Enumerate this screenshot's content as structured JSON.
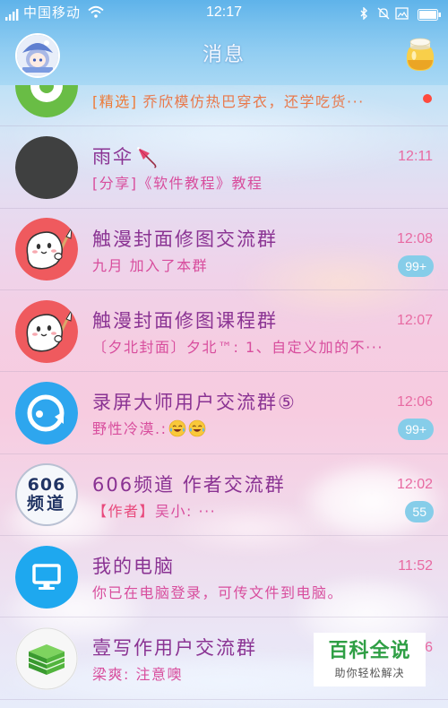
{
  "status_bar": {
    "carrier": "中国移动",
    "time": "12:17",
    "icons": [
      "signal-icon",
      "wifi-icon",
      "bluetooth-icon",
      "mute-bell-icon",
      "screenshot-icon",
      "battery-icon"
    ]
  },
  "header": {
    "title": "消息",
    "left_icon": "profile-avatar",
    "right_icon": "honey-jar-icon"
  },
  "conversations": [
    {
      "avatar": "green-ring-avatar",
      "preview_tag": "[精选]",
      "preview": "乔欣模仿热巴穿衣，还学吃货···",
      "unread_dot": true
    },
    {
      "avatar": "dark-gray-avatar",
      "name": "雨伞",
      "name_icon": "umbrella-icon",
      "preview": "[分享]《软件教程》教程",
      "time": "12:11"
    },
    {
      "avatar": "cartoon-painter-avatar",
      "name": "触漫封面修图交流群",
      "preview": "九月 加入了本群",
      "time": "12:08",
      "badge": "99+"
    },
    {
      "avatar": "cartoon-painter-avatar",
      "name": "触漫封面修图课程群",
      "preview": "〔夕北封面〕夕北™: 1、自定义加的不···",
      "time": "12:07"
    },
    {
      "avatar": "screen-recorder-avatar",
      "name": "录屏大师用户交流群⑤",
      "preview": "野性冷漠.:",
      "preview_emoji": [
        "tears-of-joy-emoji",
        "tears-of-joy-emoji"
      ],
      "time": "12:06",
      "badge": "99+"
    },
    {
      "avatar": "channel-606-avatar",
      "avatar_text": [
        "606",
        "频道"
      ],
      "name": "606频道 作者交流群",
      "preview_tag": "【作者】",
      "preview": "吴小: ···",
      "time": "12:02",
      "badge": "55"
    },
    {
      "avatar": "computer-avatar",
      "name": "我的电脑",
      "preview": "你已在电脑登录，可传文件到电脑。",
      "time": "11:52"
    },
    {
      "avatar": "green-books-avatar",
      "name": "壹写作用户交流群",
      "preview": "梁爽: 注意噢",
      "time": "6"
    }
  ],
  "watermark": {
    "title": "百科全说",
    "subtitle": "助你轻松解决"
  },
  "colors": {
    "name_text": "#8a3393",
    "preview_text": "#d84d9d",
    "time_text": "#e86aa2",
    "badge": "#86cde9",
    "unread_dot": "#ff4a3d",
    "featured_tag": "#ee7a36",
    "featured_text": "#e9784a",
    "author_tag": "#e8497c",
    "watermark_title": "#2f9f45"
  }
}
